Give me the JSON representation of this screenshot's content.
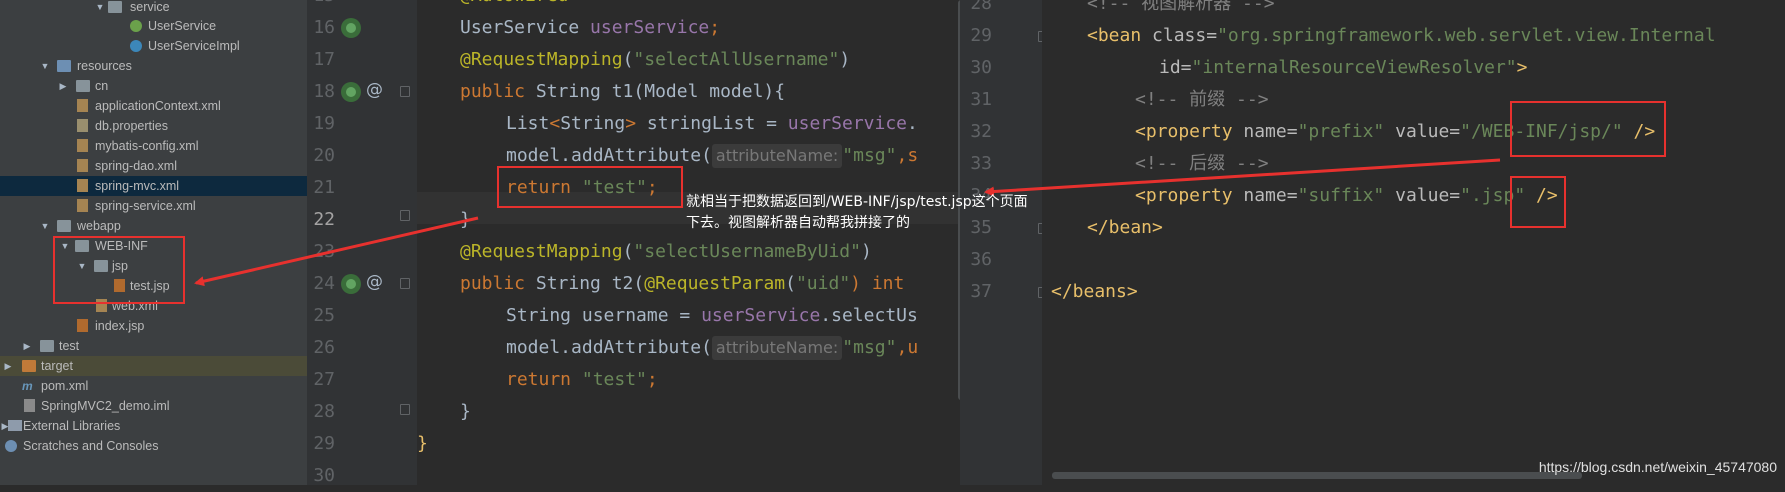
{
  "tree": {
    "items": [
      {
        "label": "service",
        "icon": "folder-icon"
      },
      {
        "label": "UserService",
        "icon": "interface-icon"
      },
      {
        "label": "UserServiceImpl",
        "icon": "class-icon"
      },
      {
        "label": "resources",
        "icon": "resources-folder-icon"
      },
      {
        "label": "cn",
        "icon": "folder-icon"
      },
      {
        "label": "applicationContext.xml",
        "icon": "xml-file-icon"
      },
      {
        "label": "db.properties",
        "icon": "properties-file-icon"
      },
      {
        "label": "mybatis-config.xml",
        "icon": "xml-file-icon"
      },
      {
        "label": "spring-dao.xml",
        "icon": "xml-file-icon"
      },
      {
        "label": "spring-mvc.xml",
        "icon": "xml-file-icon"
      },
      {
        "label": "spring-service.xml",
        "icon": "xml-file-icon"
      },
      {
        "label": "webapp",
        "icon": "folder-icon"
      },
      {
        "label": "WEB-INF",
        "icon": "folder-icon"
      },
      {
        "label": "jsp",
        "icon": "folder-icon"
      },
      {
        "label": "test.jsp",
        "icon": "jsp-file-icon"
      },
      {
        "label": "web.xml",
        "icon": "xml-file-icon"
      },
      {
        "label": "index.jsp",
        "icon": "jsp-file-icon"
      },
      {
        "label": "test",
        "icon": "folder-icon"
      },
      {
        "label": "target",
        "icon": "excluded-folder-icon"
      },
      {
        "label": "pom.xml",
        "icon": "maven-icon"
      },
      {
        "label": "SpringMVC2_demo.iml",
        "icon": "iml-file-icon"
      },
      {
        "label": "External Libraries",
        "icon": "libraries-icon"
      },
      {
        "label": "Scratches and Consoles",
        "icon": "scratches-icon"
      }
    ]
  },
  "editor1": {
    "line_numbers": [
      "16",
      "17",
      "18",
      "19",
      "20",
      "21",
      "22",
      "23",
      "24",
      "25",
      "26",
      "27",
      "28",
      "29",
      "30"
    ],
    "current_line": "22",
    "top_fragment": "@Autowired",
    "tokens": {
      "userservice_type": "UserService ",
      "userservice_field": "userService",
      "semicolon": ";",
      "req_mapping": "@RequestMapping",
      "paren_open": "(",
      "paren_close": ")",
      "mapping1": "\"selectAllUsername\"",
      "kw_public": "public ",
      "string_type": "String ",
      "t1_sig": "t1(Model model){",
      "list_decl_a": "List",
      "lt": "<",
      "gt": ">",
      "string_word": "String",
      "list_decl_b": " stringList = ",
      "dot": ".",
      "model_add": "model.addAttribute(",
      "hint_attr": "attributeName:",
      "msg_lit": "\"msg\"",
      "trail1": ",s",
      "trail2": ",u",
      "kw_return": "return ",
      "test_lit": "\"test\"",
      "close_brace": "}",
      "mapping2": "\"selectUsernameByUid\"",
      "t2_sig_a": "t2(",
      "req_param": "@RequestParam",
      "uid_lit": "\"uid\"",
      "kw_int": ") int",
      "username_decl": "String username = ",
      "select_call": ".selectUs",
      "final_brace": "}"
    }
  },
  "editor2": {
    "line_numbers": [
      "28",
      "29",
      "30",
      "31",
      "32",
      "33",
      "34",
      "35",
      "36",
      "37"
    ],
    "lines": {
      "l28": "<!-- 视图解析器 -->",
      "l29_tag": "<bean ",
      "l29_attr": "class=",
      "l29_val": "\"org.springframework.web.servlet.view.Internal",
      "l30_attr": "id=",
      "l30_val": "\"internalResourceViewResolver\"",
      "l30_end": ">",
      "l31": "<!-- 前缀 -->",
      "property_tag": "<property ",
      "name_attr": "name=",
      "prefix_val": "\"prefix\"",
      "value_attr": " value=",
      "quote": "\"",
      "prefix_path": "/WEB-INF/jsp/",
      "self_close": " />",
      "l33": "<!-- 后缀 -->",
      "suffix_val": "\"suffix\"",
      "suffix_ext": ".jsp",
      "l35": "</bean>",
      "l37": "</beans>"
    }
  },
  "annotation": {
    "line1": "就相当于把数据返回到/WEB-INF/jsp/test.jsp这个页面",
    "line2": "下去。视图解析器自动帮我拼接了的"
  },
  "watermark": "https://blog.csdn.net/weixin_45747080",
  "colors": {
    "keyword": "#cc7832",
    "string": "#6a8759",
    "annotation": "#bbb529",
    "field": "#9876aa",
    "comment": "#808080",
    "xml_tag": "#e8bf6a",
    "highlight_box": "#e7312e"
  }
}
